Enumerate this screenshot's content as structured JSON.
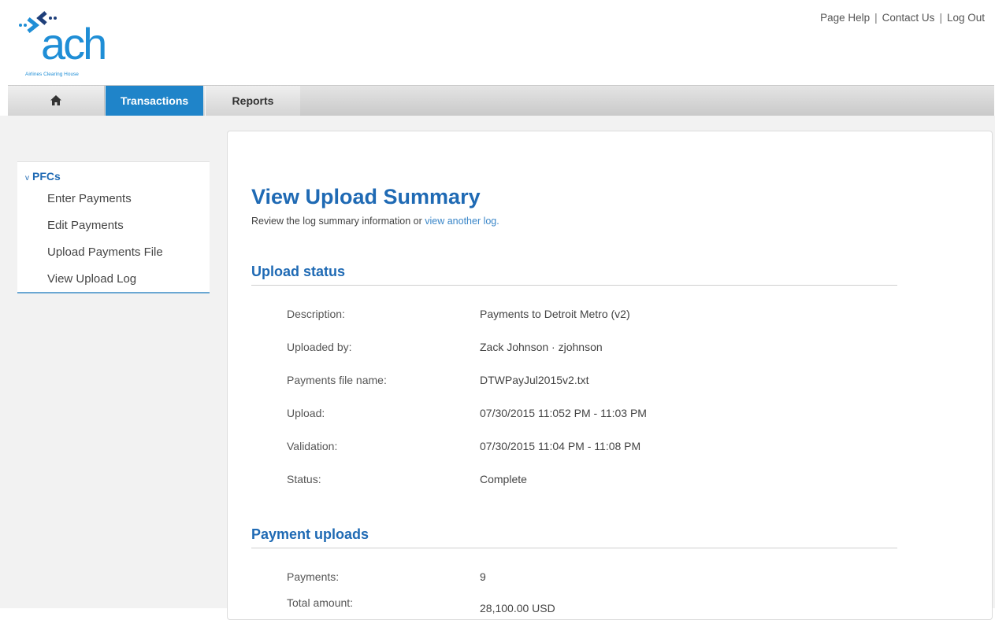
{
  "header": {
    "logo_text": "ach",
    "logo_tagline": "Airlines Clearing House",
    "links": [
      "Page Help",
      "Contact Us",
      "Log Out"
    ],
    "separator": "|"
  },
  "nav": {
    "home_icon": "home-icon",
    "transactions": "Transactions",
    "reports": "Reports"
  },
  "sidebar": {
    "heading_caret": "v",
    "heading": "PFCs",
    "items": [
      "Enter Payments",
      "Edit Payments",
      "Upload Payments File",
      "View Upload Log"
    ]
  },
  "main": {
    "title": "View Upload Summary",
    "intro_prefix": "Review the log summary information or ",
    "intro_link": "view another log."
  },
  "upload_status": {
    "title": "Upload status",
    "rows": [
      {
        "label": "Description:",
        "value": "Payments to Detroit Metro (v2)"
      },
      {
        "label": "Uploaded by:",
        "value": "Zack Johnson · zjohnson"
      },
      {
        "label": "Payments file name:",
        "value": "DTWPayJul2015v2.txt"
      },
      {
        "label": "Upload:",
        "value": "07/30/2015 11:052 PM - 11:03 PM"
      },
      {
        "label": "Validation:",
        "value": "07/30/2015 11:04 PM - 11:08 PM"
      },
      {
        "label": "Status:",
        "value": "Complete"
      }
    ]
  },
  "payment_uploads": {
    "title": "Payment uploads",
    "rows": [
      {
        "label": "Payments:",
        "value": "9"
      },
      {
        "label": "Total amount:",
        "value": "28,100.00 USD"
      }
    ]
  },
  "colors": {
    "brand_blue": "#1f8ed6",
    "heading_blue": "#1f6ab4",
    "nav_active": "#1f84c9",
    "link_blue": "#3a86c8"
  }
}
